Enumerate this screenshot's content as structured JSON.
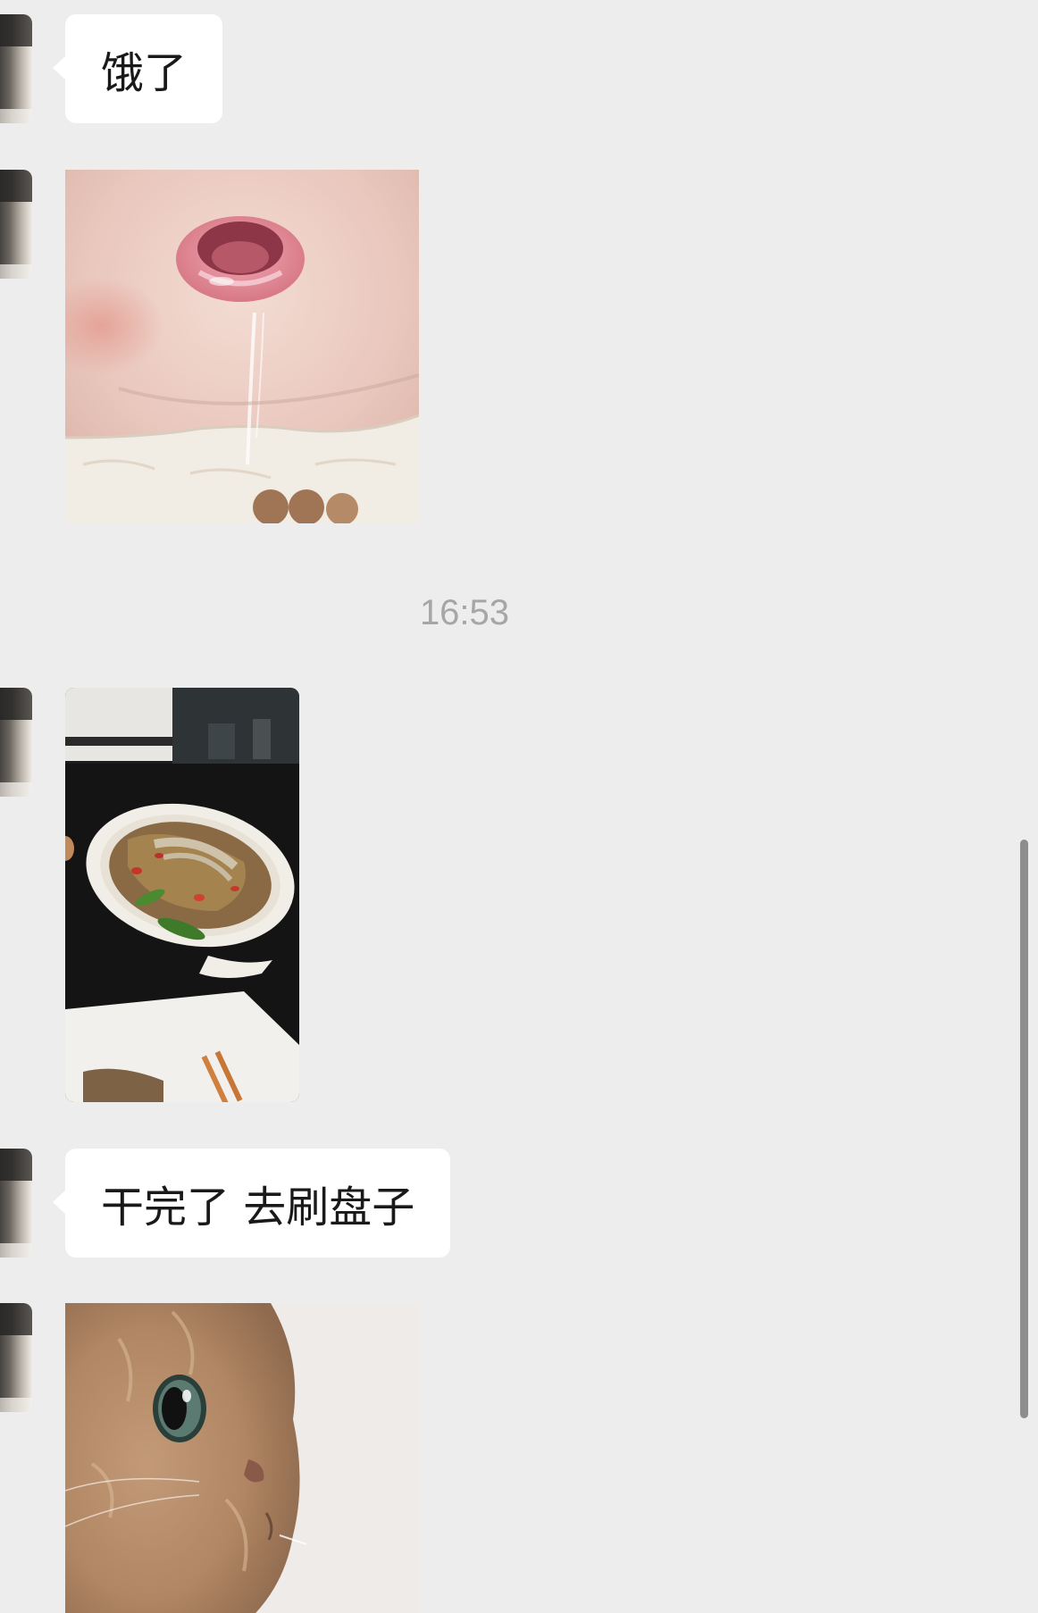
{
  "messages": [
    {
      "type": "text",
      "text": "饿了"
    },
    {
      "type": "image",
      "image_name": "baby-drooling-sticker"
    },
    {
      "type": "timestamp",
      "text": "16:53"
    },
    {
      "type": "image",
      "image_name": "plate-of-stir-fried-fish-photo"
    },
    {
      "type": "text",
      "text": "干完了 去刷盘子"
    },
    {
      "type": "image",
      "image_name": "cat-closeup-sticker"
    }
  ],
  "colors": {
    "background": "#ededed",
    "bubble": "#ffffff",
    "text": "#191919",
    "timestamp": "#a6a6a6",
    "scrollbar": "#8d8d8d"
  }
}
